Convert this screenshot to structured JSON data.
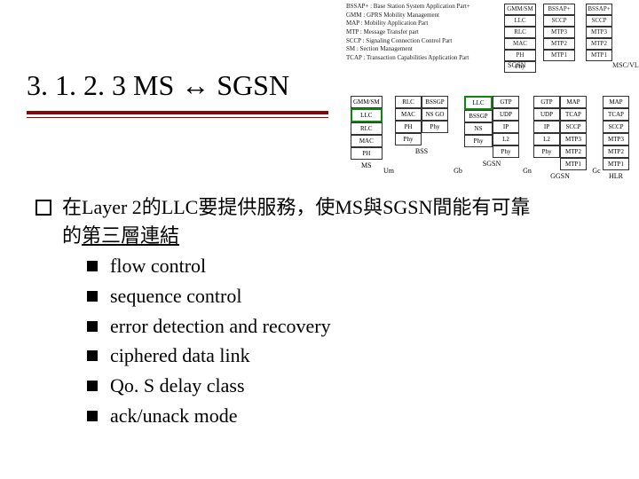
{
  "title": "3. 1. 2. 3 MS ↔ SGSN",
  "bullet1_line1": "在Layer 2的LLC要提供服務，使MS與SGSN間能有可靠",
  "bullet1_line2_pre": "的",
  "bullet1_line2_ul": "第三層連結",
  "sub": [
    "flow control",
    "sequence control",
    "error detection and recovery",
    "ciphered data link",
    "Qo. S delay class",
    "ack/unack mode"
  ],
  "abbrevs": [
    "BSSAP+ : Base Station System Application Part+",
    "GMM : GPRS Mobility Management",
    "MAP : Mobility Application Part",
    "MTP : Message Transfer part",
    "SCCP : Signaling Connection Control Part",
    "SM : Section Management",
    "TCAP : Transaction Capabilities Application Part"
  ],
  "top_stack_a": [
    "GMM/SM",
    "LLC",
    "RLC",
    "MAC",
    "PH",
    "Phy"
  ],
  "top_stack_b": [
    "BSSAP+",
    "SCCP",
    "MTP3",
    "MTP2",
    "MTP1"
  ],
  "top_stack_c": [
    "BSSAP+",
    "SCCP",
    "MTP3",
    "MTP2",
    "MTP1"
  ],
  "top_node_a": "SGSN",
  "top_node_b": "MSC/VLR",
  "lower_columns": [
    {
      "name": "MS",
      "cells": [
        "GMM/SM",
        "LLC",
        "RLC",
        "MAC",
        "PH"
      ],
      "hlIndex": 1
    },
    {
      "name": "Um",
      "cells": []
    },
    {
      "name": "BSS",
      "cells": [
        "RLC",
        "MAC",
        "PH",
        "Phy"
      ],
      "pair": [
        "BSSGP",
        "NS GO",
        "Phy"
      ]
    },
    {
      "name": "Gb",
      "cells": []
    },
    {
      "name": "SGSN",
      "cells": [
        "GTP",
        "UDP",
        "IP",
        "L2",
        "Phy"
      ],
      "left": [
        "LLC",
        "BSSGP",
        "NS",
        "Phy"
      ],
      "hlLeft": 0
    },
    {
      "name": "Gn",
      "cells": []
    },
    {
      "name": "GGSN",
      "cells": [
        "MAP",
        "TCAP",
        "SCCP",
        "MTP3",
        "MTP2",
        "MTP1"
      ],
      "left": [
        "GTP",
        "UDP",
        "IP",
        "L2",
        "Phy"
      ]
    },
    {
      "name": "Gc",
      "cells": []
    },
    {
      "name": "HLR",
      "cells": [
        "MAP",
        "TCAP",
        "SCCP",
        "MTP3",
        "MTP2",
        "MTP1"
      ]
    }
  ]
}
